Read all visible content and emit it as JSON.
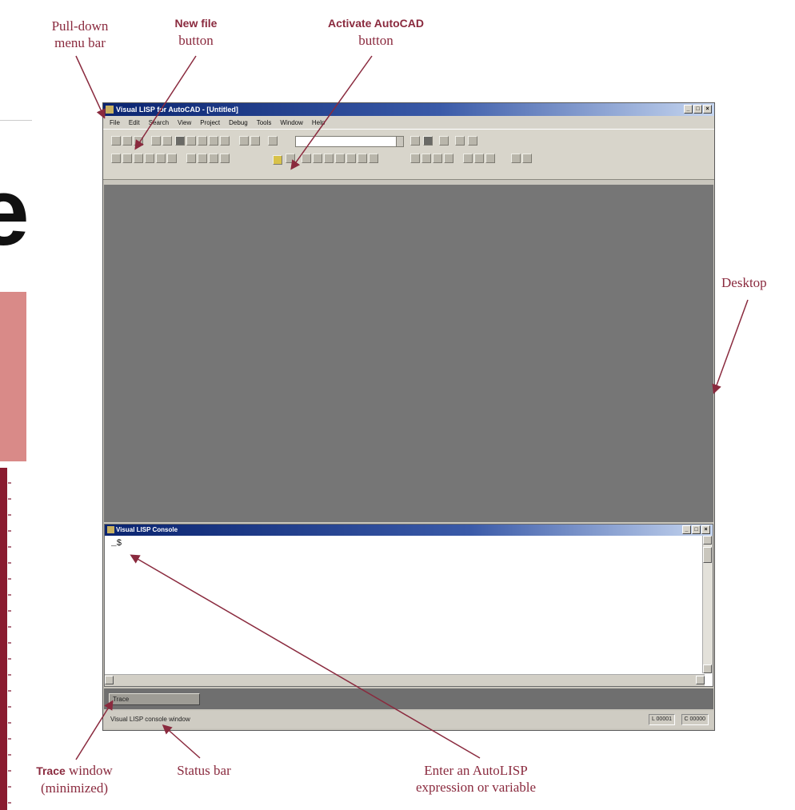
{
  "annotations": {
    "pulldown_line1": "Pull-down",
    "pulldown_line2": "menu bar",
    "newfile_line1": "New file",
    "newfile_line2": "button",
    "activate_line1": "Activate AutoCAD",
    "activate_line2": "button",
    "desktop": "Desktop",
    "trace_bold": "Trace",
    "trace_rest": " window",
    "trace_line2": "(minimized)",
    "status": "Status bar",
    "enter_line1": "Enter an AutoLISP",
    "enter_line2": "expression or variable"
  },
  "app": {
    "title": "Visual LISP for AutoCAD - [Untitled]",
    "window_buttons": [
      "_",
      "□",
      "×"
    ],
    "menu": [
      "File",
      "Edit",
      "Search",
      "View",
      "Project",
      "Debug",
      "Tools",
      "Window",
      "Help"
    ],
    "toolbar_combo_value": "",
    "console_title": "Visual LISP Console",
    "console_prompt": "_$",
    "trace_label": "Trace",
    "status_text": "Visual LISP console window",
    "status_panels": [
      "L 00001",
      "C 00000"
    ]
  },
  "colors": {
    "annotation": "#8a2a3e",
    "desktop": "#767676",
    "titlebar": "#0a2470"
  }
}
